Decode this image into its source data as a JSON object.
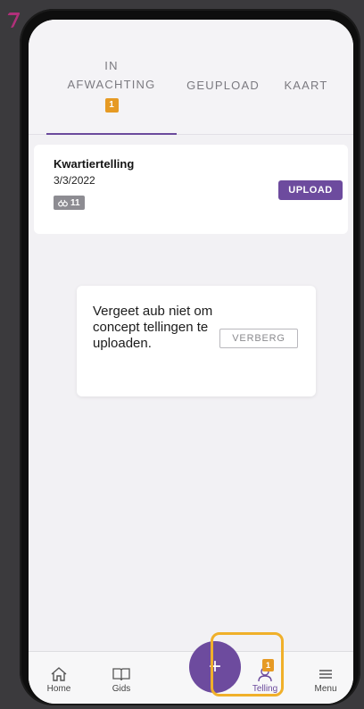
{
  "tabs": [
    {
      "label_line1": "IN",
      "label_line2": "AFWACHTING",
      "badge": "1",
      "active": true
    },
    {
      "label": "GEUPLOAD"
    },
    {
      "label": "KAART"
    }
  ],
  "card": {
    "title": "Kwartiertelling",
    "date": "3/3/2022",
    "chip_count": "11",
    "upload_label": "UPLOAD"
  },
  "reminder": {
    "text": "Vergeet aub niet om concept tellingen te uploaden.",
    "hide_label": "VERBERG"
  },
  "fab": {
    "label": "+"
  },
  "nav": {
    "home": "Home",
    "gids": "Gids",
    "telling": "Telling",
    "telling_badge": "1",
    "menu": "Menu"
  },
  "colors": {
    "accent": "#6d4b9e",
    "badge": "#e69a24",
    "highlight": "#f0b02a"
  }
}
